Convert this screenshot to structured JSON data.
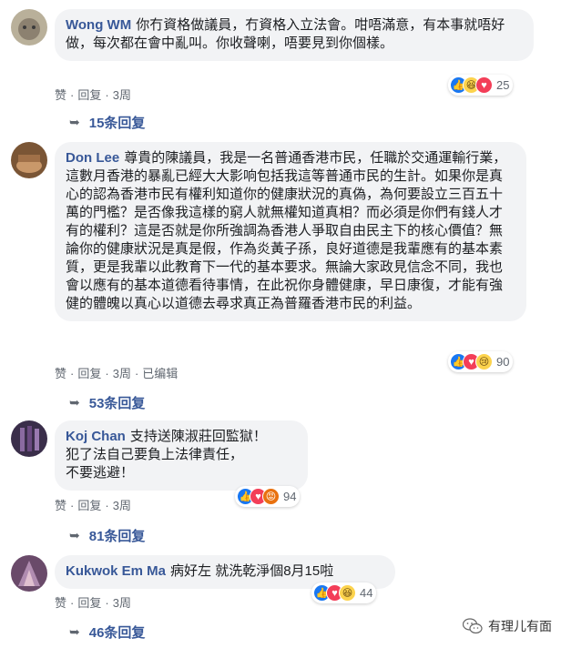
{
  "comments": [
    {
      "name": "Wong WM",
      "text": "你冇資格做議員，冇資格入立法會。咁唔滿意，有本事就唔好做，每次都在會中亂叫。你收聲喇，唔要見到你個樣。",
      "like": "赞",
      "reply": "回复",
      "time": "3周",
      "reactions": [
        "like",
        "haha",
        "love"
      ],
      "count": "25",
      "replies": "15条回复"
    },
    {
      "name": "Don Lee",
      "text": "尊貴的陳議員，我是一名普通香港市民，任職於交通運輸行業，這數月香港的暴亂已經大大影响包括我這等普通市民的生計。如果你是真心的認為香港市民有權利知道你的健康狀況的真偽，為何要設立三百五十萬的門檻？是否像我這樣的窮人就無權知道真相？而必須是你們有錢人才有的權利？這是否就是你所強調為香港人爭取自由民主下的核心價值？無論你的健康狀況是真是假，作為炎黃子孫，良好道德是我輩應有的基本素質，更是我輩以此教育下一代的基本要求。無論大家政見信念不同，我也會以應有的基本道德看待事情，在此祝你身體健康，早日康復，才能有強健的體魄以真心以道德去尋求真正為普羅香港市民的利益。",
      "like": "赞",
      "reply": "回复",
      "time": "3周",
      "edited": "已编辑",
      "reactions": [
        "like",
        "love",
        "sad"
      ],
      "count": "90",
      "replies": "53条回复"
    },
    {
      "name": "Koj Chan",
      "text": "支持送陳淑莊回監獄！\n犯了法自己要負上法律責任，\n不要逃避！",
      "like": "赞",
      "reply": "回复",
      "time": "3周",
      "reactions": [
        "like",
        "love",
        "angry"
      ],
      "count": "94",
      "replies": "81条回复"
    },
    {
      "name": "Kukwok Em Ma",
      "text": "病好左 就洗乾淨個8月15啦",
      "like": "赞",
      "reply": "回复",
      "time": "3周",
      "reactions": [
        "like",
        "love",
        "haha"
      ],
      "count": "44",
      "replies": "46条回复"
    }
  ],
  "watermark": "有理儿有面",
  "colors": {
    "name": "#385898",
    "bubble": "#f2f3f5",
    "like": "#1877f2",
    "love": "#f33e58"
  }
}
